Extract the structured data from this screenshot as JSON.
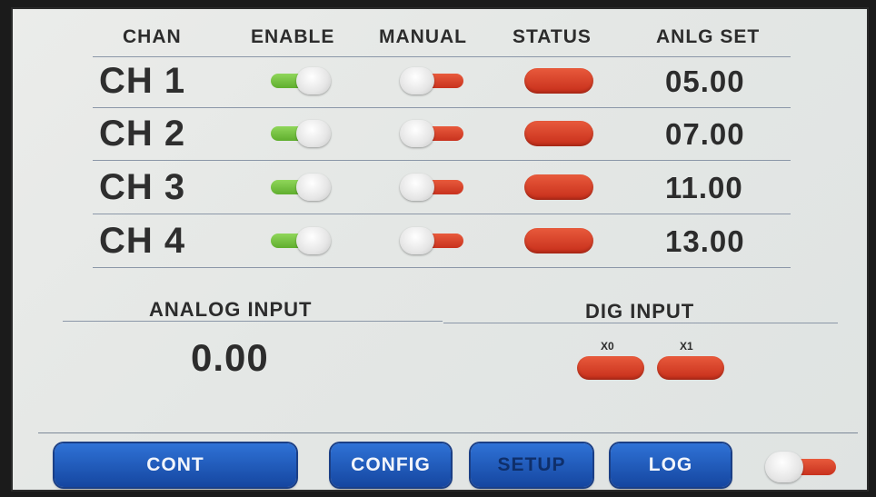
{
  "table": {
    "headers": {
      "chan": "CHAN",
      "enable": "ENABLE",
      "manual": "MANUAL",
      "status": "STATUS",
      "anlg_set": "ANLG SET"
    },
    "rows": [
      {
        "chan": "CH 1",
        "enable": true,
        "manual": false,
        "status": "red",
        "anlg_set": "05.00"
      },
      {
        "chan": "CH 2",
        "enable": true,
        "manual": false,
        "status": "red",
        "anlg_set": "07.00"
      },
      {
        "chan": "CH 3",
        "enable": true,
        "manual": false,
        "status": "red",
        "anlg_set": "11.00"
      },
      {
        "chan": "CH 4",
        "enable": true,
        "manual": false,
        "status": "red",
        "anlg_set": "13.00"
      }
    ]
  },
  "analog_input": {
    "title": "ANALOG INPUT",
    "value": "0.00"
  },
  "dig_input": {
    "title": "DIG INPUT",
    "channels": [
      {
        "label": "X0",
        "state": "red"
      },
      {
        "label": "X1",
        "state": "red"
      }
    ]
  },
  "footer": {
    "buttons": [
      "CONT",
      "CONFIG",
      "SETUP",
      "LOG"
    ],
    "toggle_on": false
  },
  "colors": {
    "enable_on": "#6cbc3a",
    "indicator_off": "#d63c22",
    "button_blue": "#1f5bc0"
  }
}
